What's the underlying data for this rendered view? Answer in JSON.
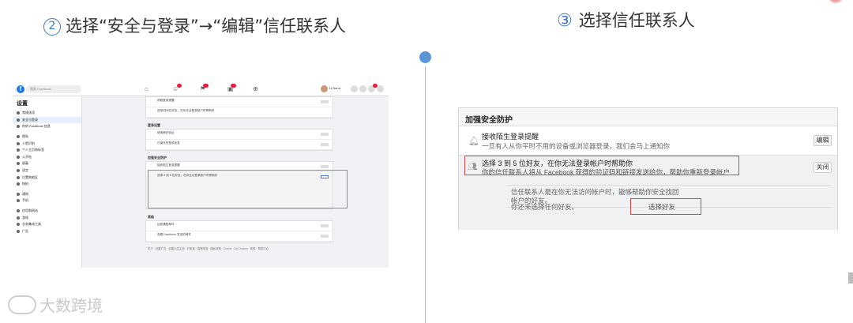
{
  "steps": {
    "step2": {
      "num": "2",
      "text": "选择“安全与登录”→“编辑”信任联系人"
    },
    "step3": {
      "num": "③",
      "text": "选择信任联系人"
    }
  },
  "fb": {
    "search_placeholder": "搜索 Facebook",
    "user_name": "Li Nana",
    "sidebar": {
      "title": "设置",
      "items": [
        "常规选项",
        "安全与登录",
        "你的 Facebook 信息",
        "隐私",
        "人脸识别",
        "个人主页和标签",
        "公开帖",
        "屏蔽",
        "语言",
        "位置和地区",
        "快拍",
        "通知",
        "手机",
        "应用和网站",
        "游戏",
        "业务集成工具",
        "广告"
      ]
    },
    "sections": {
      "recommended_rows": [
        "获取登录提醒",
        "选择3到5位好友，在你无法登录帐户时帮助你"
      ],
      "login_header": "登录设置",
      "login_rows": [
        "使用两步验证",
        "已保存的登录信息"
      ],
      "extra_header": "加强安全防护",
      "extra_rows": [
        "接收陌生登录提醒",
        "选择 3 到 5 位好友，在你无法登录帐户时帮助你"
      ],
      "advanced_header": "高级",
      "advanced_rows": [
        "加密通知邮件",
        "查看 Facebook 发送的邮件"
      ],
      "button": "编辑"
    },
    "footer": "关于 · 创建广告 · 创建公共主页 · 开发者 · 招聘信息 · 隐私政策 · Cookie · Ad Choices · 条款 · 帮助中心"
  },
  "panel": {
    "title": "加强安全防护",
    "row1": {
      "title": "接收陌生登录提醒",
      "desc": "一旦有人从你平时不用的设备或浏览器登录，我们会马上通知你",
      "button": "编辑",
      "icon": "bell-icon"
    },
    "row2": {
      "title": "选择 3 到 5 位好友，在你无法登录帐户时帮助你",
      "desc": "你的信任联系人将从 Facebook 获得的验证码和链接发送给你，帮助你重新登录帐户",
      "button": "关闭",
      "icon": "friends-icon"
    },
    "trusted": {
      "line1": "信任联系人是在你无法访问帐户时，能够帮助你安全找回",
      "line2": "帐户的好友。",
      "none": "你还未选择任何好友。",
      "choose": "选择好友"
    }
  },
  "watermark": "大数跨境",
  "colors": {
    "accent": "#3a78c9",
    "dot": "#5b95d6",
    "highlight": "#d64545",
    "facebook": "#1877f2"
  }
}
